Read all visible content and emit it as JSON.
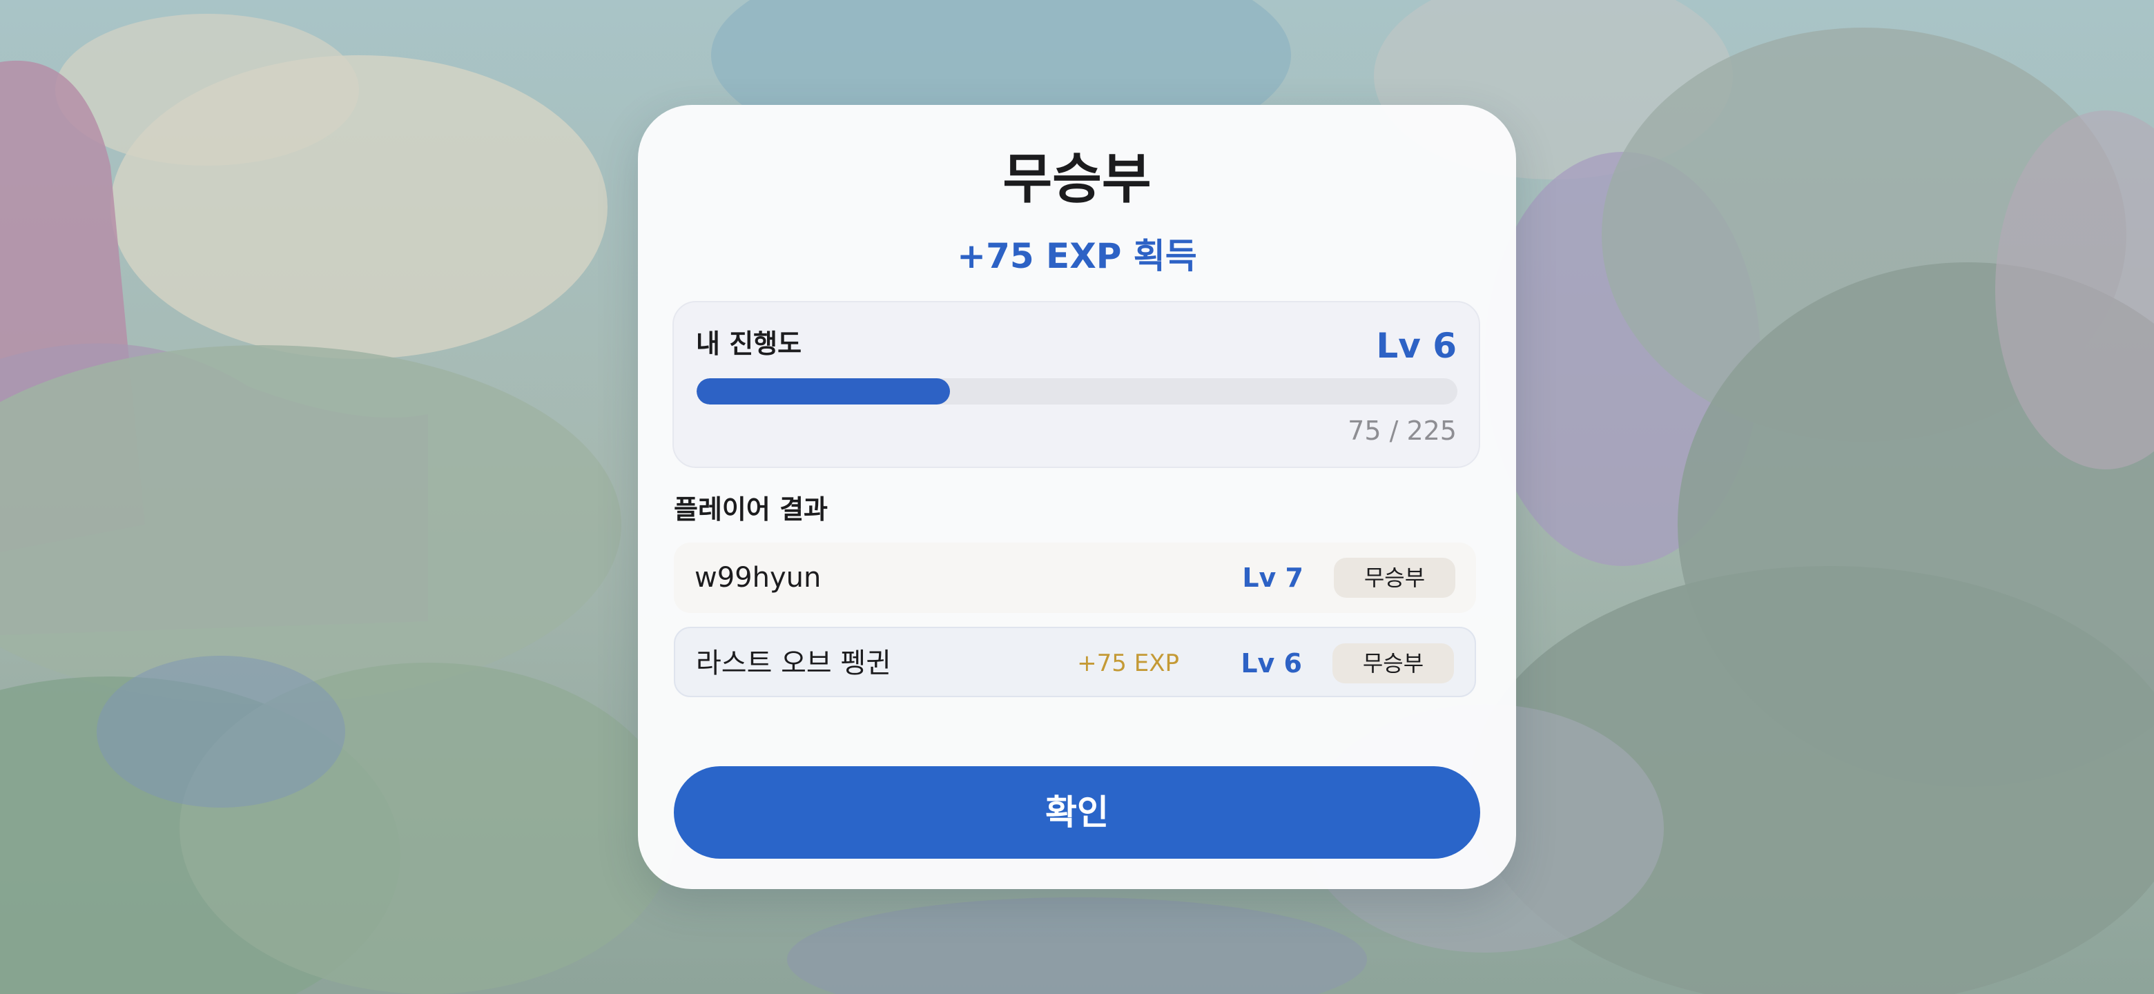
{
  "result": {
    "title": "무승부",
    "exp_gained": "+75 EXP 획득"
  },
  "progress": {
    "label": "내 진행도",
    "level": "Lv 6",
    "count": "75 / 225",
    "current": 75,
    "max": 225
  },
  "players": {
    "section_title": "플레이어 결과",
    "rows": [
      {
        "name": "w99hyun",
        "exp": "",
        "level": "Lv 7",
        "result": "무승부"
      },
      {
        "name": "라스트 오브 펭귄",
        "exp": "+75 EXP",
        "level": "Lv 6",
        "result": "무승부"
      }
    ]
  },
  "confirm_label": "확인",
  "colors": {
    "accent": "#2d62c5",
    "button": "#2a65c9",
    "exp": "#c49a36",
    "badge": "#ebe7e1"
  }
}
